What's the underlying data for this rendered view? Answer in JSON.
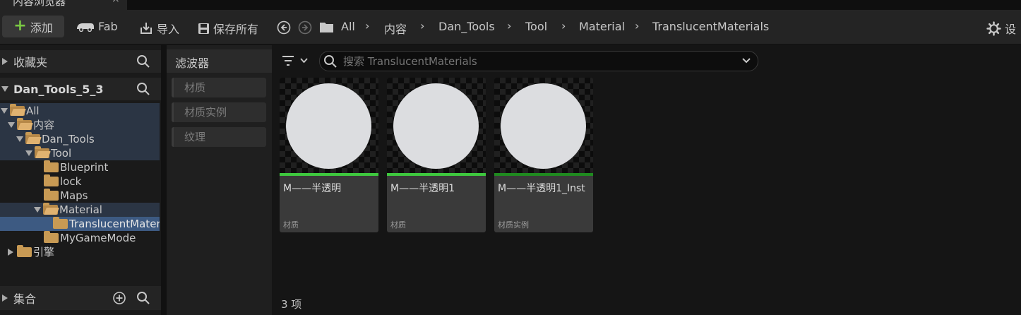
{
  "tab": {
    "title": "内容浏览器",
    "close": "×"
  },
  "toolbar": {
    "add_label": "添加",
    "fab_label": "Fab",
    "import_label": "导入",
    "save_all_label": "保存所有",
    "settings_label": "设"
  },
  "breadcrumbs": [
    "All",
    "内容",
    "Dan_Tools",
    "Tool",
    "Material",
    "TranslucentMaterials"
  ],
  "favorites": {
    "label": "收藏夹"
  },
  "project": {
    "label": "Dan_Tools_5_3"
  },
  "tree": [
    {
      "label": "All"
    },
    {
      "label": "内容"
    },
    {
      "label": "Dan_Tools"
    },
    {
      "label": "Tool"
    },
    {
      "label": "Blueprint"
    },
    {
      "label": "lock"
    },
    {
      "label": "Maps"
    },
    {
      "label": "Material"
    },
    {
      "label": "TranslucentMaterials"
    },
    {
      "label": "MyGameMode"
    },
    {
      "label": "引擎"
    }
  ],
  "collections": {
    "label": "集合"
  },
  "filters": {
    "title": "滤波器",
    "items": [
      "材质",
      "材质实例",
      "纹理"
    ]
  },
  "search": {
    "placeholder": "搜索 TranslucentMaterials"
  },
  "assets": [
    {
      "name": "M——半透明",
      "type": "材质",
      "color": "#3ec83e"
    },
    {
      "name": "M——半透明1",
      "type": "材质",
      "color": "#3ec83e"
    },
    {
      "name": "M——半透明1_Inst",
      "type": "材质实例",
      "color": "#1f8a1f"
    }
  ],
  "status": {
    "count": "3 项"
  },
  "colors": {
    "accent_green": "#7ac943",
    "selection": "#2b3544",
    "selected_row": "#3d5a82",
    "folder": "#c89a54"
  }
}
